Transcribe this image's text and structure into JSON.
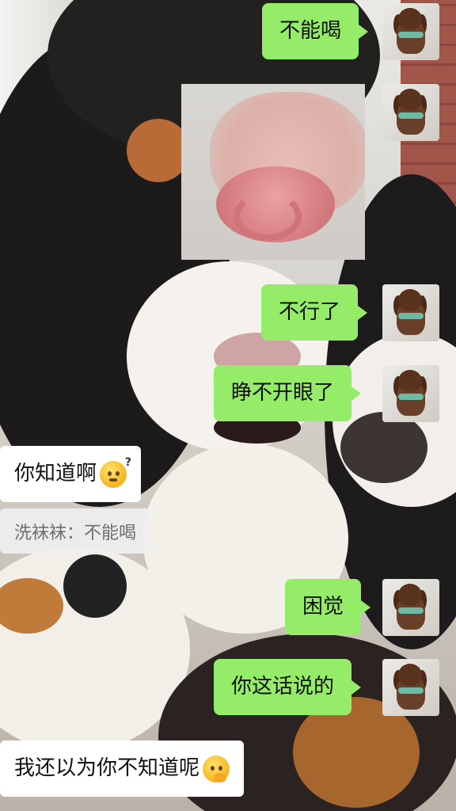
{
  "messages": [
    {
      "side": "right",
      "text": "不能喝"
    },
    {
      "side": "right",
      "type": "sticker",
      "sticker": "pig-snout-sticker"
    },
    {
      "side": "right",
      "text": "不行了"
    },
    {
      "side": "right",
      "text": "睁不开眼了"
    },
    {
      "side": "left",
      "text": "你知道啊",
      "emoji": "thinking-face-emoji"
    },
    {
      "side": "left",
      "type": "quote",
      "text": "洗袜袜：不能喝"
    },
    {
      "side": "right",
      "text": "困觉"
    },
    {
      "side": "right",
      "text": "你这话说的"
    },
    {
      "side": "left",
      "text": "我还以为你不知道呢",
      "emoji": "hand-over-mouth-emoji"
    }
  ],
  "colors": {
    "own_bubble": "#95ec69",
    "other_bubble": "#ffffff",
    "quote_bg": "#eeeeee",
    "quote_text": "#6e6e6e"
  },
  "avatar": {
    "icon": "dog-avatar-icon"
  }
}
